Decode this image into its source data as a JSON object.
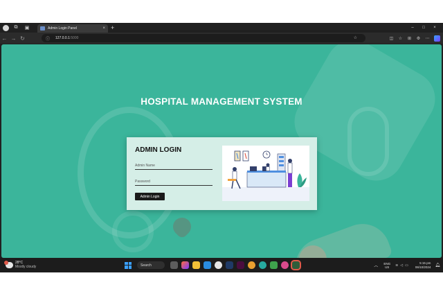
{
  "browser": {
    "tab_title": "Admin Login Panel",
    "tab_close": "×",
    "new_tab": "+",
    "url_host": "127.0.0.1",
    "url_port": ":5000",
    "window_controls": [
      "–",
      "□",
      "×"
    ]
  },
  "page": {
    "title": "HOSPITAL MANAGEMENT SYSTEM",
    "login": {
      "heading": "ADMIN LOGIN",
      "username_placeholder": "Admin Name",
      "password_placeholder": "Password",
      "button_label": "Admin Login"
    },
    "accent_color": "#3bb59b"
  },
  "taskbar": {
    "weather_temp": "28°C",
    "weather_desc": "Mostly cloudy",
    "search_label": "Search",
    "lang_top": "ENG",
    "lang_bottom": "US",
    "time": "5:15 pm",
    "date": "06/10/2024"
  }
}
